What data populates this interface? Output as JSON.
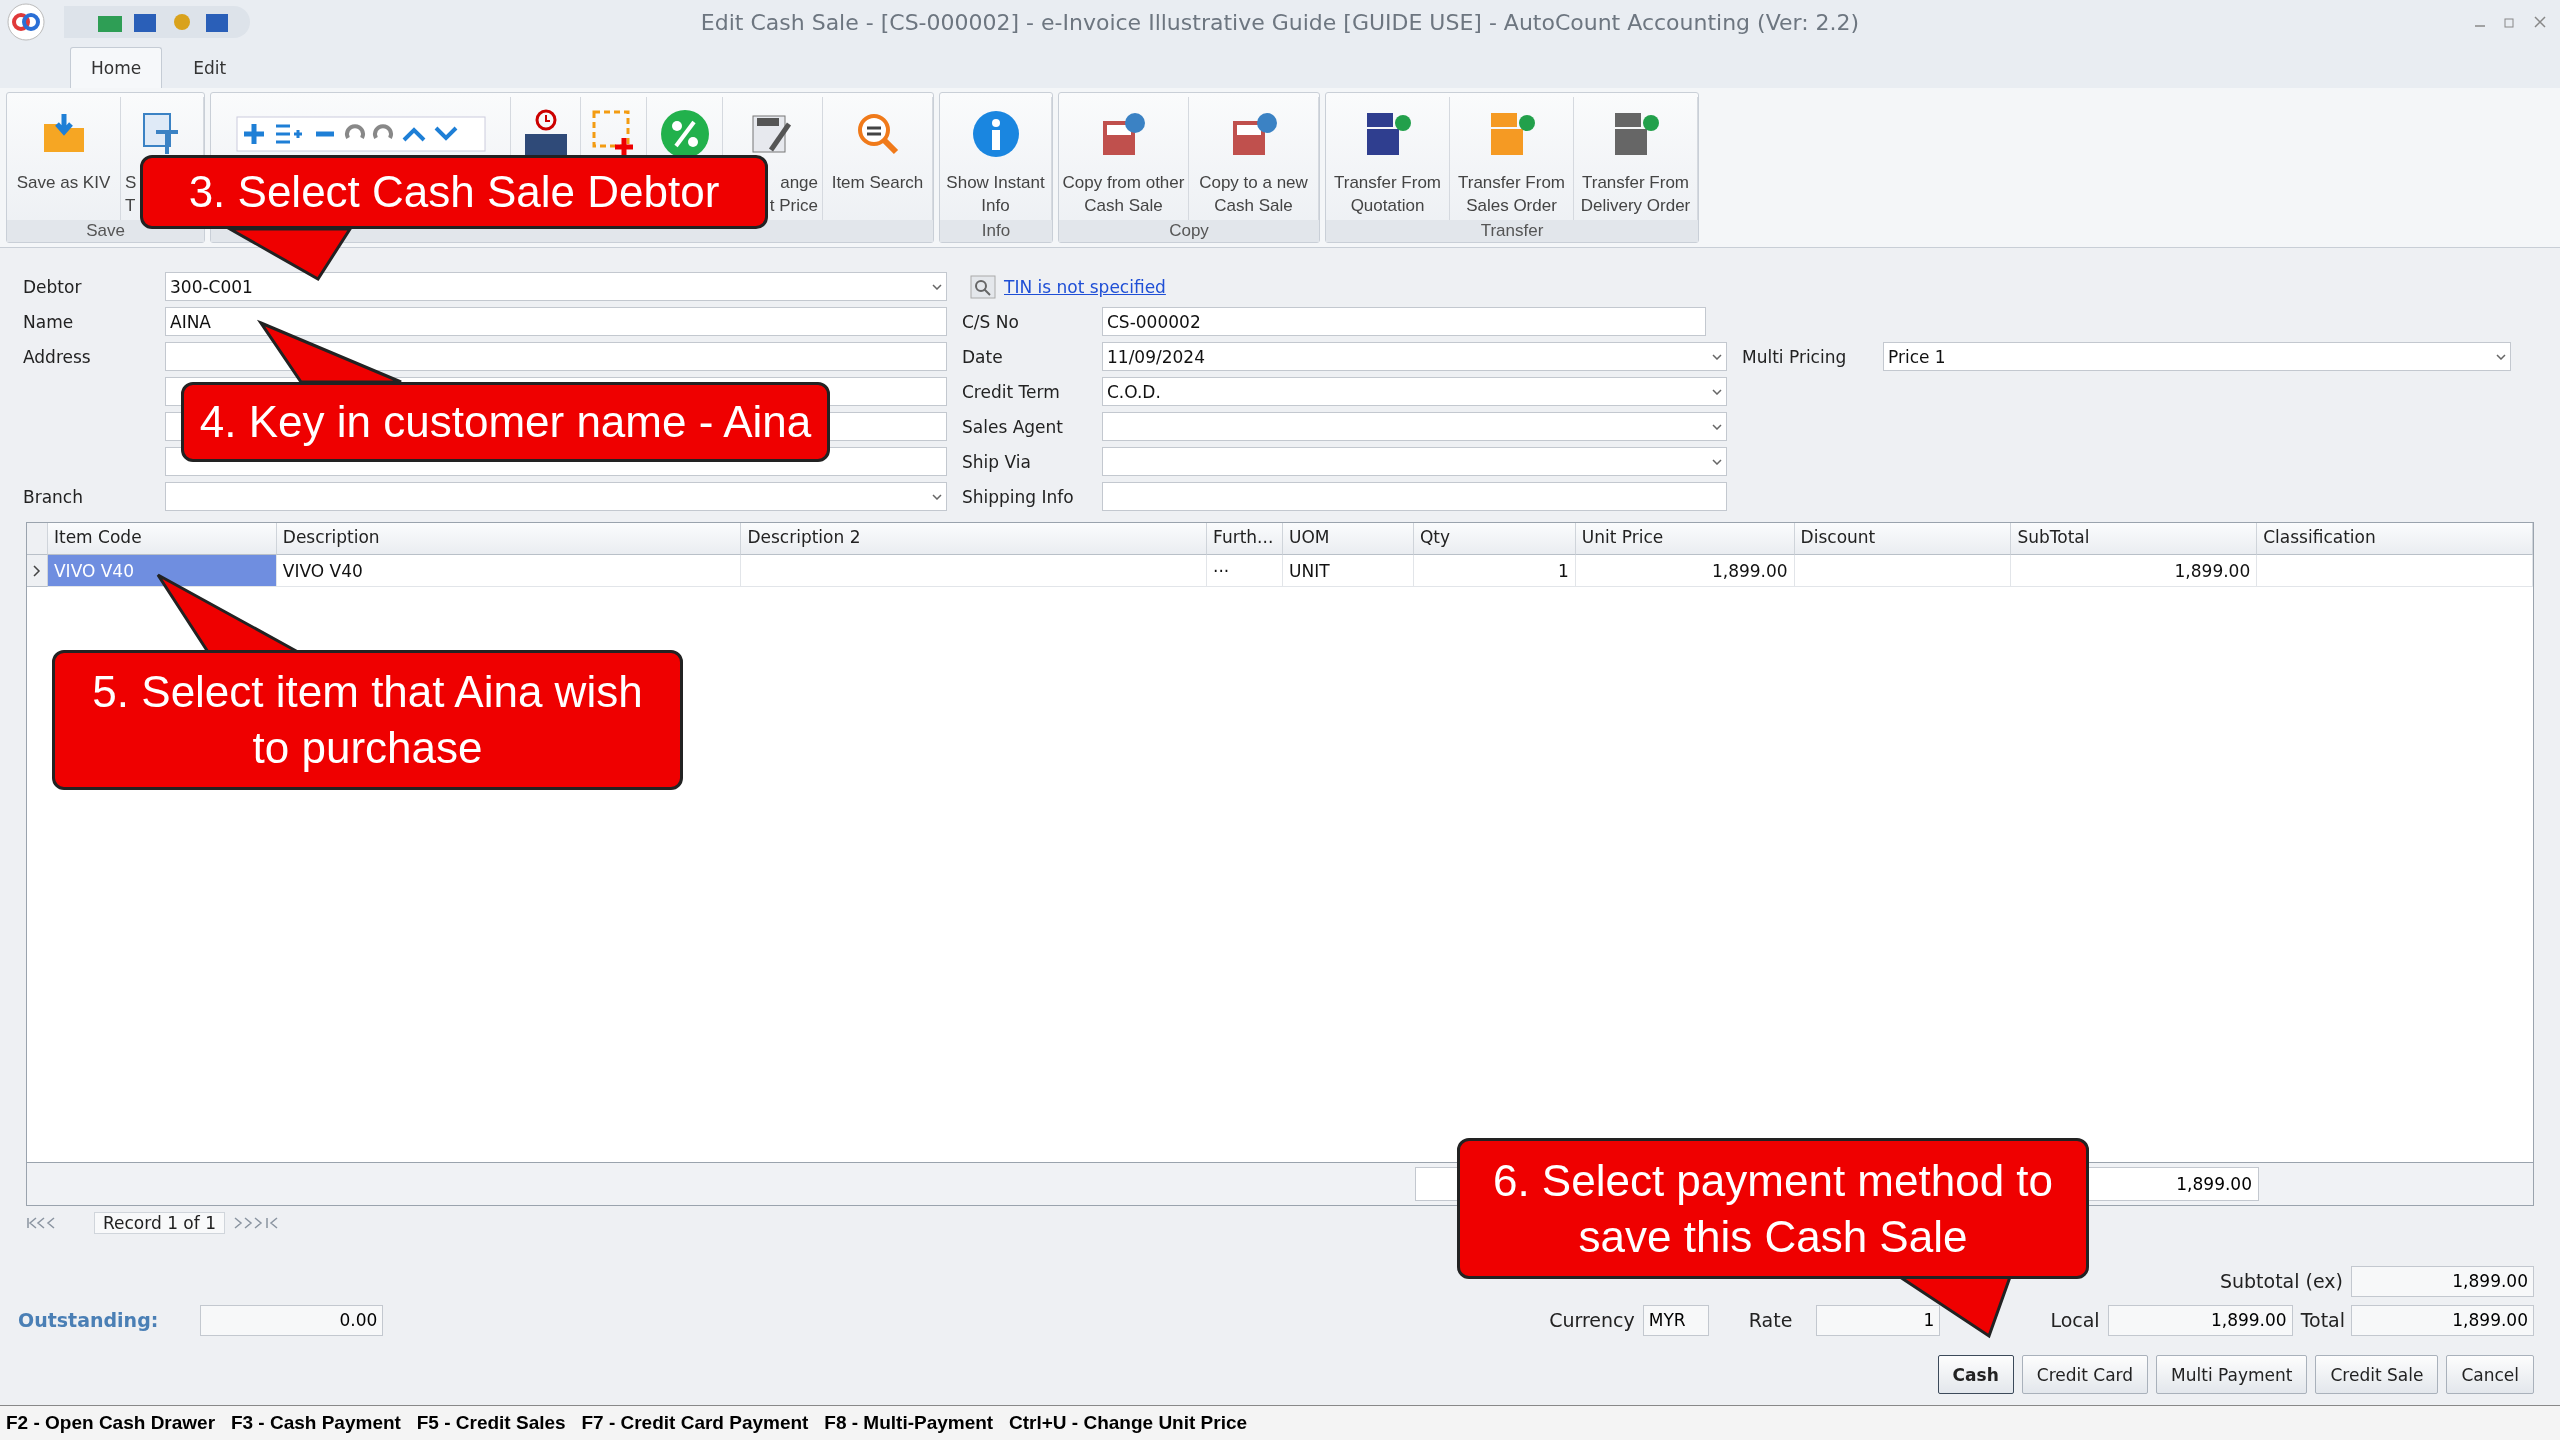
{
  "window": {
    "title": "Edit Cash Sale - [CS-000002] - e-Invoice Illustrative Guide [GUIDE USE] - AutoCount Accounting (Ver: 2.2)"
  },
  "tabs": [
    {
      "label": "Home",
      "selected": true
    },
    {
      "label": "Edit",
      "selected": false
    }
  ],
  "ribbon": [
    {
      "label": "Save",
      "buttons": [
        {
          "kind": "save",
          "lines": [
            "Save as KIV"
          ]
        },
        {
          "kind": "template",
          "lines": [
            "S",
            "T"
          ]
        }
      ]
    },
    {
      "buttons": [
        {
          "kind": "edit-strip"
        },
        {
          "kind": "tax"
        },
        {
          "kind": "add-box"
        },
        {
          "kind": "percent"
        },
        {
          "kind": "unit-price",
          "lines": [
            "ange",
            "t Price"
          ]
        },
        {
          "kind": "search",
          "lines": [
            "Item Search"
          ]
        }
      ]
    },
    {
      "label": "Info",
      "buttons": [
        {
          "kind": "info",
          "lines": [
            "Show Instant",
            "Info"
          ]
        }
      ]
    },
    {
      "label": "Copy",
      "buttons": [
        {
          "kind": "copy-from",
          "lines": [
            "Copy from other",
            "Cash Sale"
          ]
        },
        {
          "kind": "copy-to",
          "lines": [
            "Copy to a new",
            "Cash Sale"
          ]
        }
      ]
    },
    {
      "label": "Transfer",
      "buttons": [
        {
          "kind": "qt",
          "lines": [
            "Transfer From",
            "Quotation"
          ]
        },
        {
          "kind": "so",
          "lines": [
            "Transfer From",
            "Sales Order"
          ]
        },
        {
          "kind": "do",
          "lines": [
            "Transfer From",
            "Delivery Order"
          ]
        }
      ]
    }
  ],
  "form": {
    "debtor": {
      "label": "Debtor",
      "value": "300-C001",
      "dropdown": true
    },
    "tin_link": "TIN is not specified",
    "name": {
      "label": "Name",
      "value": "AINA"
    },
    "address": {
      "label": "Address"
    },
    "branch": {
      "label": "Branch",
      "dropdown": true
    },
    "middle": [
      {
        "label": "C/S No",
        "value": "CS-000002",
        "dropdown": false
      },
      {
        "label": "Date",
        "value": "11/09/2024",
        "dropdown": true
      },
      {
        "label": "Credit Term",
        "value": "C.O.D.",
        "dropdown": true
      },
      {
        "label": "Sales Agent",
        "dropdown": true
      },
      {
        "label": "Ship Via",
        "dropdown": true
      },
      {
        "label": "Shipping Info",
        "dropdown": false
      }
    ],
    "multi_pricing": {
      "label": "Multi Pricing",
      "value": "Price 1",
      "dropdown": true
    }
  },
  "grid": {
    "columns": [
      "Item Code",
      "Description",
      "Description 2",
      "Furth...",
      "UOM",
      "Qty",
      "Unit Price",
      "Discount",
      "SubTotal",
      "Classification"
    ],
    "rows": [
      {
        "selected": true,
        "cells": [
          "VIVO V40",
          "VIVO V40",
          null,
          "···",
          "UNIT",
          "1",
          "1,899.00",
          null,
          "1,899.00",
          null
        ]
      }
    ],
    "footer_total": "1,899.00",
    "navigator": "Record 1 of 1"
  },
  "totals": {
    "outstanding_label": "Outstanding:",
    "outstanding": "0.00",
    "currency_label": "Currency",
    "currency": "MYR",
    "rate_label": "Rate",
    "rate": "1",
    "subtotal_label": "Subtotal (ex)",
    "subtotal": "1,899.00",
    "local_label": "Local",
    "local": "1,899.00",
    "total_label": "Total",
    "total": "1,899.00"
  },
  "buttons": [
    {
      "label": "Cash",
      "default": true
    },
    {
      "label": "Credit Card",
      "default": false
    },
    {
      "label": "Multi Payment",
      "default": false
    },
    {
      "label": "Credit Sale",
      "default": false
    },
    {
      "label": "Cancel",
      "default": false
    }
  ],
  "status_bar": "F2 - Open Cash Drawer   F3 - Cash Payment   F5 - Credit Sales   F7 - Credit Card Payment   F8 - Multi-Payment   Ctrl+U - Change Unit Price",
  "callouts": [
    "3. Select Cash Sale Debtor",
    "4. Key in customer name - Aina",
    "5. Select item that Aina wish to purchase",
    "6. Select payment method to save this Cash Sale"
  ]
}
